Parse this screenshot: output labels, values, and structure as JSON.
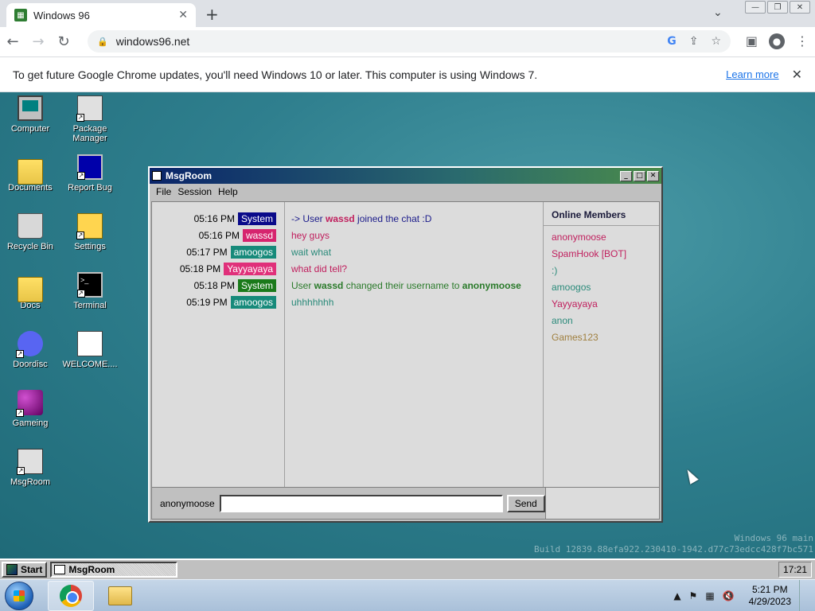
{
  "browser": {
    "tab_title": "Windows 96",
    "tab_close": "✕",
    "new_tab": "+",
    "url": "windows96.net",
    "window_controls": [
      "—",
      "❐",
      "✕"
    ]
  },
  "infobar": {
    "message": "To get future Google Chrome updates, you'll need Windows 10 or later. This computer is using Windows 7.",
    "link": "Learn more",
    "close": "✕"
  },
  "desktop": {
    "icons": [
      {
        "label": "Computer",
        "icon": "computer-icon"
      },
      {
        "label": "Package Manager",
        "icon": "package-manager-icon"
      },
      {
        "label": "Documents",
        "icon": "documents-folder-icon"
      },
      {
        "label": "Report Bug",
        "icon": "report-bug-icon"
      },
      {
        "label": "Recycle Bin",
        "icon": "recycle-bin-icon"
      },
      {
        "label": "Settings",
        "icon": "settings-icon"
      },
      {
        "label": "Docs",
        "icon": "docs-folder-icon"
      },
      {
        "label": "Terminal",
        "icon": "terminal-icon"
      },
      {
        "label": "Doordisc",
        "icon": "doordisc-icon"
      },
      {
        "label": "WELCOME....",
        "icon": "welcome-doc-icon"
      },
      {
        "label": "Gameing",
        "icon": "gameing-icon"
      },
      {
        "label": "MsgRoom",
        "icon": "msgroom-icon"
      }
    ],
    "build_line1": "Windows 96 main",
    "build_line2": "Build 12839.88efa922.230410-1942.d77c73edcc428f7bc571"
  },
  "msgroom": {
    "title": "MsgRoom",
    "menu": [
      "File",
      "Session",
      "Help"
    ],
    "messages": [
      {
        "time": "05:16 PM",
        "user": "System",
        "badge_color": "#0a0a8a",
        "text_color": "#1a1a8a",
        "parts": [
          "-> User ",
          "wassd",
          " joined the chat :D"
        ]
      },
      {
        "time": "05:16 PM",
        "user": "wassd",
        "badge_color": "#d6246e",
        "text_color": "#c0205e",
        "parts": [
          "hey guys"
        ]
      },
      {
        "time": "05:17 PM",
        "user": "amoogos",
        "badge_color": "#168a7a",
        "text_color": "#2a8a7a",
        "parts": [
          "wait what"
        ]
      },
      {
        "time": "05:18 PM",
        "user": "Yayyayaya",
        "badge_color": "#e0307a",
        "text_color": "#c0205e",
        "parts": [
          "what did tell?"
        ]
      },
      {
        "time": "05:18 PM",
        "user": "System",
        "badge_color": "#1a7a1a",
        "text_color": "#2a7a2a",
        "parts": [
          "User ",
          "wassd",
          " changed their username to ",
          "anonymoose"
        ]
      },
      {
        "time": "05:19 PM",
        "user": "amoogos",
        "badge_color": "#168a7a",
        "text_color": "#2a8a7a",
        "parts": [
          "uhhhhhhh"
        ]
      }
    ],
    "members_title": "Online Members",
    "members": [
      {
        "name": "anonymoose",
        "color": "#c0205e"
      },
      {
        "name": "SpamHook [BOT]",
        "color": "#c0205e"
      },
      {
        "name": ":)",
        "color": "#2a8a7a"
      },
      {
        "name": "amoogos",
        "color": "#2a8a7a"
      },
      {
        "name": "Yayyayaya",
        "color": "#c0205e"
      },
      {
        "name": "anon",
        "color": "#2a8a7a"
      },
      {
        "name": "Games123",
        "color": "#a08040"
      }
    ],
    "input_user": "anonymoose",
    "input_value": "",
    "send_label": "Send"
  },
  "w96_taskbar": {
    "start_label": "Start",
    "task_label": "MsgRoom",
    "clock": "17:21"
  },
  "win7_taskbar": {
    "time": "5:21 PM",
    "date": "4/29/2023"
  }
}
